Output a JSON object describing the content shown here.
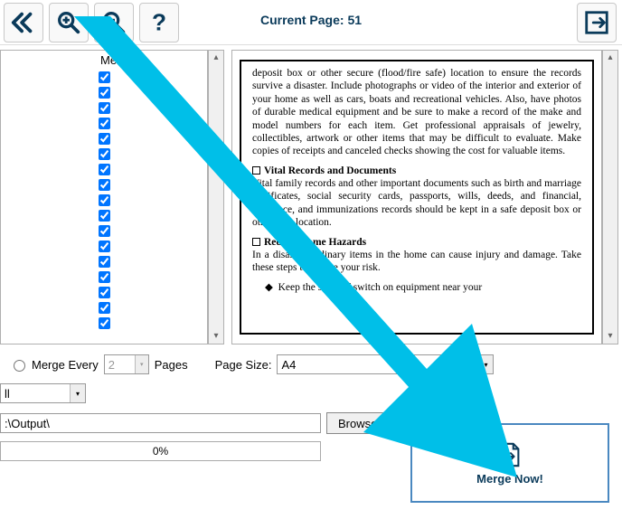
{
  "toolbar": {
    "current_page_label": "Current Page: 51"
  },
  "left": {
    "header": "Merge"
  },
  "options": {
    "merge_every_label": "Merge Every",
    "merge_every_value": "2",
    "pages_label": "Pages",
    "page_size_label": "Page Size:",
    "page_size_value": "A4",
    "dropdown_value": "ll",
    "output_path": ":\\Output\\",
    "browse_label": "Browse",
    "progress_text": "0%"
  },
  "merge_button": {
    "label": "Merge Now!"
  },
  "preview": {
    "para1": "deposit box or other secure (flood/fire safe) location to ensure the records survive a disaster. Include photographs or video of the interior and exterior of your home as well as cars, boats and recreational vehicles. Also, have photos of durable medical equipment and be sure to make a record of the make and model numbers for each item. Get professional appraisals of jewelry, collectibles, artwork or other items that may be difficult to evaluate. Make copies of receipts and canceled checks showing the cost for valuable items.",
    "sec1_title": "Vital Records and Documents",
    "sec1_body": "Vital family records and other important documents such as birth and marriage certificates, social security cards, passports, wills, deeds, and financial, insurance, and immunizations records should be kept in a safe deposit box or other safe location.",
    "sec2_title": "Reduce Home Hazards",
    "sec2_body": "In a disaster, ordinary items in the home can cause injury and damage. Take these steps to reduce your risk.",
    "bullet": "Keep the shut-off switch on equipment near your"
  },
  "colors": {
    "accent": "#00BFE8",
    "ink": "#0a3a5a"
  }
}
